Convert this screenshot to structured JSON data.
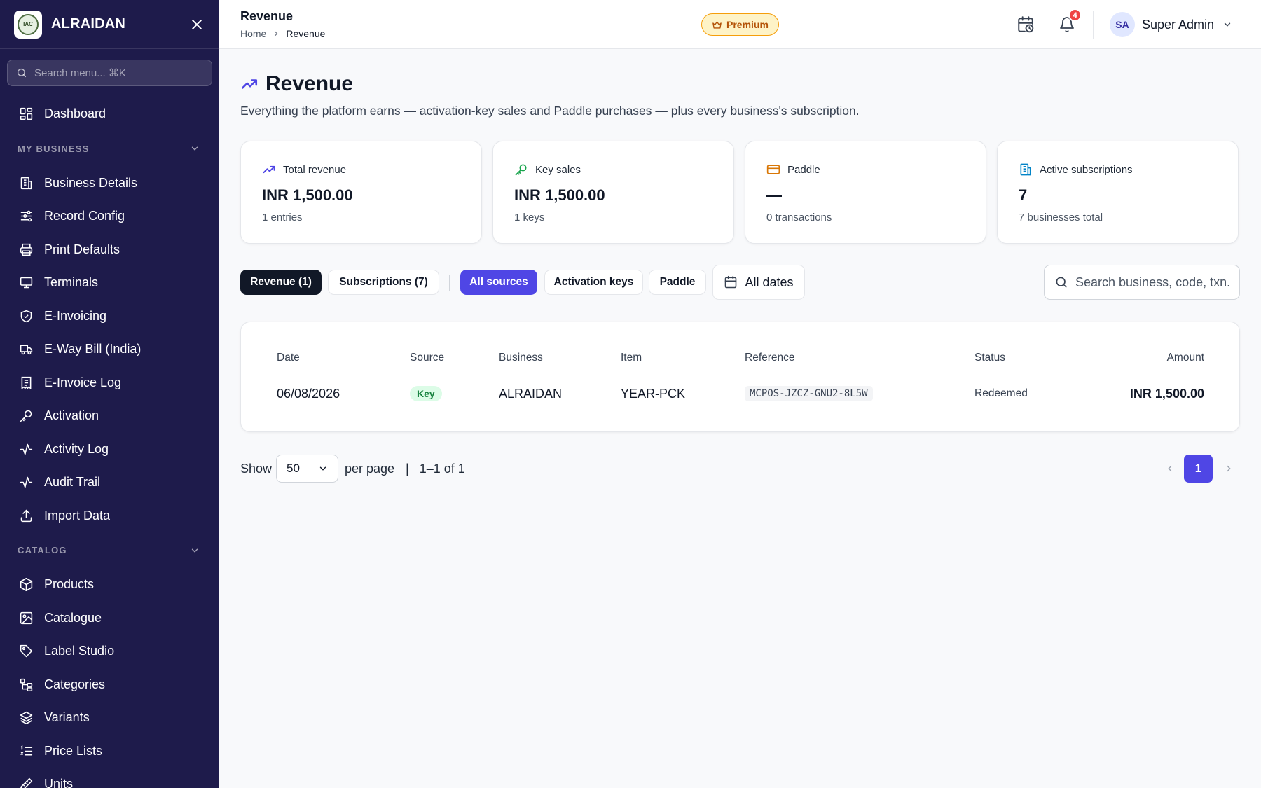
{
  "sidebar": {
    "brand": "ALRAIDAN",
    "logo_text": "IAC",
    "search_placeholder": "Search menu... ⌘K",
    "dashboard": {
      "label": "Dashboard",
      "icon": "grid-icon"
    },
    "sections": [
      {
        "title": "MY BUSINESS",
        "items": [
          {
            "label": "Business Details",
            "icon": "building-icon"
          },
          {
            "label": "Record Config",
            "icon": "sliders-icon"
          },
          {
            "label": "Print Defaults",
            "icon": "printer-icon"
          },
          {
            "label": "Terminals",
            "icon": "monitor-icon"
          },
          {
            "label": "E-Invoicing",
            "icon": "shield-check-icon"
          },
          {
            "label": "E-Way Bill (India)",
            "icon": "truck-icon"
          },
          {
            "label": "E-Invoice Log",
            "icon": "receipt-icon"
          },
          {
            "label": "Activation",
            "icon": "key-icon"
          },
          {
            "label": "Activity Log",
            "icon": "activity-icon"
          },
          {
            "label": "Audit Trail",
            "icon": "activity-icon"
          },
          {
            "label": "Import Data",
            "icon": "upload-icon"
          }
        ]
      },
      {
        "title": "CATALOG",
        "items": [
          {
            "label": "Products",
            "icon": "package-icon"
          },
          {
            "label": "Catalogue",
            "icon": "image-icon"
          },
          {
            "label": "Label Studio",
            "icon": "tag-icon"
          },
          {
            "label": "Categories",
            "icon": "tree-icon"
          },
          {
            "label": "Variants",
            "icon": "layers-icon"
          },
          {
            "label": "Price Lists",
            "icon": "list-ordered-icon"
          },
          {
            "label": "Units",
            "icon": "ruler-icon"
          }
        ]
      }
    ]
  },
  "header": {
    "title": "Revenue",
    "breadcrumb": [
      "Home",
      "Revenue"
    ],
    "premium_label": "Premium",
    "notification_count": "4",
    "user_initials": "SA",
    "user_name": "Super Admin"
  },
  "page": {
    "title": "Revenue",
    "subtitle": "Everything the platform earns — activation-key sales and Paddle purchases — plus every business's subscription."
  },
  "cards": [
    {
      "label": "Total revenue",
      "value": "INR 1,500.00",
      "note": "1 entries",
      "icon": "trending-up-icon",
      "color": "#4f46e5"
    },
    {
      "label": "Key sales",
      "value": "INR 1,500.00",
      "note": "1 keys",
      "icon": "key-icon",
      "color": "#16a34a"
    },
    {
      "label": "Paddle",
      "value": "—",
      "note": "0 transactions",
      "icon": "credit-card-icon",
      "color": "#d97706"
    },
    {
      "label": "Active subscriptions",
      "value": "7",
      "note": "7 businesses total",
      "icon": "building-icon",
      "color": "#0284c7"
    }
  ],
  "filters": {
    "tabs": [
      "Revenue (1)",
      "Subscriptions (7)"
    ],
    "sources": [
      "All sources",
      "Activation keys",
      "Paddle"
    ],
    "date_label": "All dates",
    "search_placeholder": "Search business, code, txn..."
  },
  "table": {
    "columns": [
      "Date",
      "Source",
      "Business",
      "Item",
      "Reference",
      "Status",
      "Amount"
    ],
    "rows": [
      {
        "date": "06/08/2026",
        "source": "Key",
        "business": "ALRAIDAN",
        "item": "YEAR-PCK",
        "reference": "MCPOS-JZCZ-GNU2-8L5W",
        "status": "Redeemed",
        "amount": "INR 1,500.00"
      }
    ]
  },
  "pagination": {
    "show_label": "Show",
    "per_page_value": "50",
    "per_page_label": "per page",
    "separator": "|",
    "range": "1–1 of 1",
    "current_page": "1"
  },
  "colors": {
    "sidebar_bg": "#1e1b4b",
    "accent": "#4f46e5",
    "dark_pill": "#111827",
    "premium_bg": "#fef3c7",
    "badge_red": "#ef4444"
  }
}
